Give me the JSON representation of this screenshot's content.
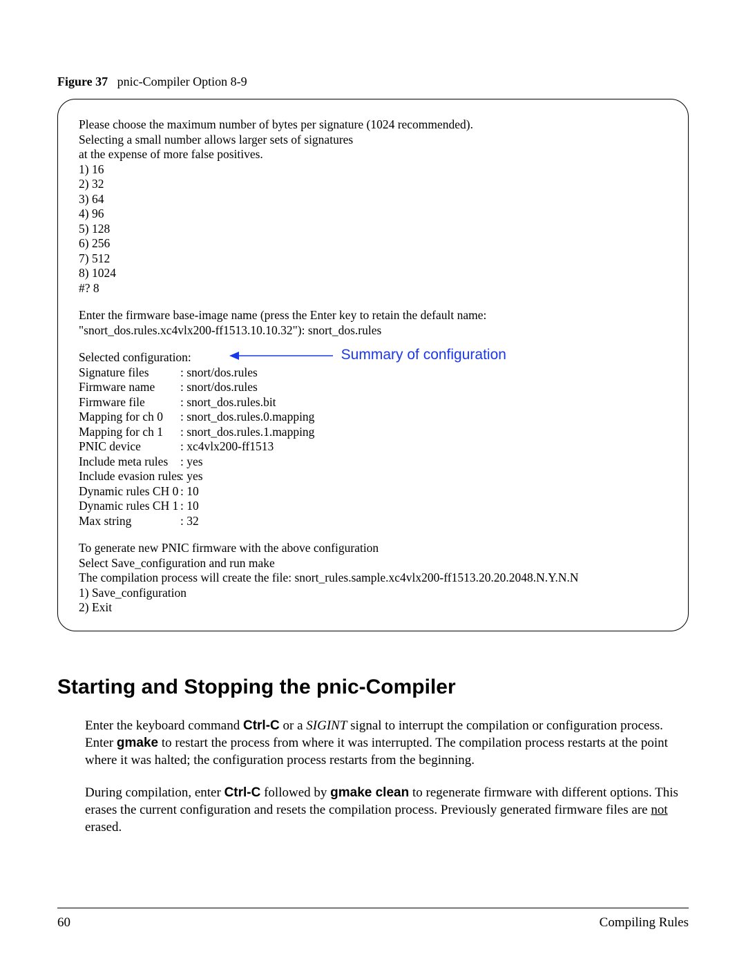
{
  "figure": {
    "label": "Figure 37",
    "caption": "pnic-Compiler Option 8-9"
  },
  "box": {
    "intro": [
      "Please choose the maximum number of bytes per signature (1024 recommended).",
      "Selecting a small number allows larger sets of signatures",
      "at the expense of more false positives."
    ],
    "options": [
      "1) 16",
      "2) 32",
      "3) 64",
      "4) 96",
      "5) 128",
      "6) 256",
      "7) 512",
      "8) 1024"
    ],
    "prompt": "#? 8",
    "firmware_prompt": [
      "Enter the firmware base-image name (press the Enter key to retain the default name:",
      "\"snort_dos.rules.xc4vlx200-ff1513.10.10.32\"): snort_dos.rules"
    ],
    "selected_header": "Selected configuration:",
    "config": [
      {
        "k": "Signature files",
        "v": ": snort/dos.rules"
      },
      {
        "k": "Firmware name",
        "v": ": snort/dos.rules"
      },
      {
        "k": "Firmware file",
        "v": ": snort_dos.rules.bit"
      },
      {
        "k": "Mapping for ch 0",
        "v": ": snort_dos.rules.0.mapping"
      },
      {
        "k": "Mapping for ch 1",
        "v": ": snort_dos.rules.1.mapping"
      },
      {
        "k": "PNIC device",
        "v": ": xc4vlx200-ff1513"
      },
      {
        "k": "Include meta rules",
        "v": ": yes"
      },
      {
        "k": "Include evasion rules",
        "v": ": yes"
      },
      {
        "k": "Dynamic rules CH 0",
        "v": ": 10"
      },
      {
        "k": "Dynamic rules CH 1",
        "v": ": 10"
      },
      {
        "k": "Max string",
        "v": ": 32"
      }
    ],
    "footer_lines": [
      "To generate new PNIC firmware with the above configuration",
      "Select Save_configuration and run make",
      "The compilation process will create the file: snort_rules.sample.xc4vlx200-ff1513.20.20.2048.N.Y.N.N",
      "1) Save_configuration",
      "2) Exit"
    ]
  },
  "annotation": "Summary of configuration",
  "heading": "Starting and Stopping the pnic-Compiler",
  "para1": {
    "t1": "Enter the keyboard command ",
    "c1": "Ctrl-C",
    "t2": " or a ",
    "i1": "SIGINT",
    "t3": " signal to interrupt the compilation or configuration process. Enter ",
    "c2": "gmake",
    "t4": " to restart the process from where it was interrupted. The compilation process restarts at the point where it was halted; the configuration process restarts from the beginning."
  },
  "para2": {
    "t1": "During compilation, enter ",
    "c1": "Ctrl-C",
    "t2": " followed by ",
    "c2": "gmake clean",
    "t3": " to regenerate firmware with different options. This erases the current configuration and resets the compilation process. Previously generated firmware files are ",
    "u1": "not",
    "t4": " erased."
  },
  "page_number": "60",
  "footer_title": "Compiling Rules"
}
